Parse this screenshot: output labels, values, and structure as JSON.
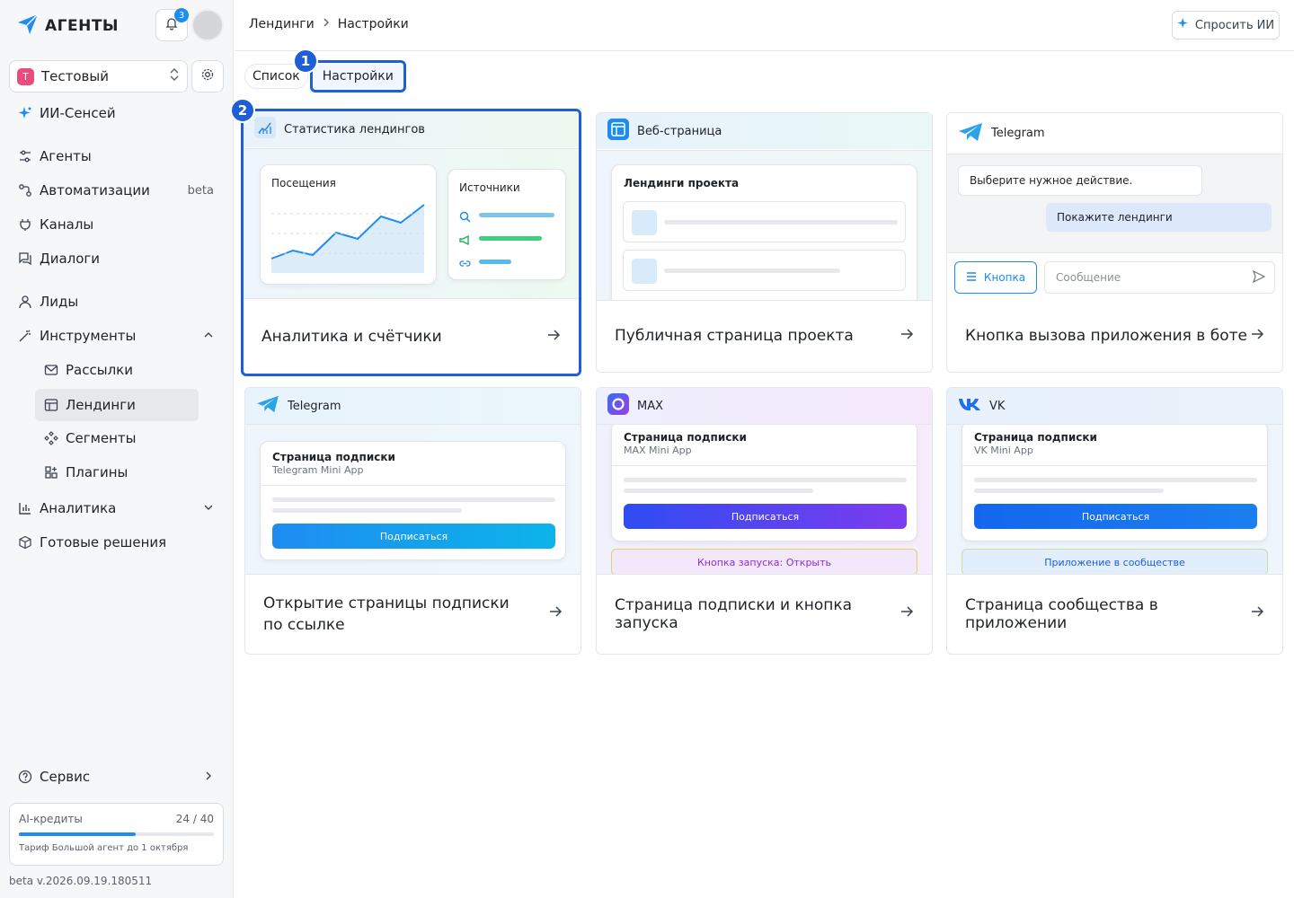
{
  "app": {
    "name": "АГЕНТЫ",
    "notifications": "3"
  },
  "workspace": {
    "initial": "Т",
    "name": "Тестовый"
  },
  "nav": {
    "ai_sensei": "ИИ-Сенсей",
    "agents": "Агенты",
    "automations": "Автоматизации",
    "automations_badge": "beta",
    "channels": "Каналы",
    "dialogs": "Диалоги",
    "leads": "Лиды",
    "tools": "Инструменты",
    "mailings": "Рассылки",
    "landings": "Лендинги",
    "segments": "Сегменты",
    "plugins": "Плагины",
    "analytics": "Аналитика",
    "ready": "Готовые решения",
    "service": "Сервис"
  },
  "credits": {
    "label": "AI-кредиты",
    "value": "24 / 40",
    "progress": 0.6,
    "plan": "Тариф Большой агент до 1 октября"
  },
  "version": "beta v.2026.09.19.180511",
  "breadcrumb": {
    "first": "Лендинги",
    "second": "Настройки"
  },
  "ask_ai": "Спросить ИИ",
  "tabs": {
    "list": "Список",
    "settings": "Настройки"
  },
  "steps": {
    "one": "1",
    "two": "2"
  },
  "cards": {
    "stats": {
      "head": "Статистика лендингов",
      "visits": "Посещения",
      "sources": "Источники",
      "title": "Аналитика и счётчики"
    },
    "web": {
      "head": "Веб-страница",
      "inner": "Лендинги проекта",
      "title": "Публичная страница проекта"
    },
    "tg_button": {
      "head": "Telegram",
      "bot_msg": "Выберите нужное действие.",
      "user_msg": "Покажите лендинги",
      "button": "Кнопка",
      "placeholder": "Сообщение",
      "title": "Кнопка вызова приложения в боте"
    },
    "tg_sub": {
      "head": "Telegram",
      "page": "Страница подписки",
      "app": "Telegram Mini App",
      "btn": "Подписаться",
      "title": "Открытие страницы подписки по ссылке"
    },
    "max": {
      "head": "MAX",
      "page": "Страница подписки",
      "app": "MAX Mini App",
      "btn": "Подписаться",
      "launch": "Кнопка запуска: Открыть",
      "title": "Страница подписки и кнопка запуска"
    },
    "vk": {
      "head": "VK",
      "page": "Страница подписки",
      "app": "VK Mini App",
      "btn": "Подписаться",
      "community": "Приложение в сообществе",
      "title": "Страница сообщества в приложении"
    }
  },
  "colors": {
    "accent": "#1f5fd6",
    "blue": "#1f8cf0",
    "green": "#3ccf7c"
  }
}
